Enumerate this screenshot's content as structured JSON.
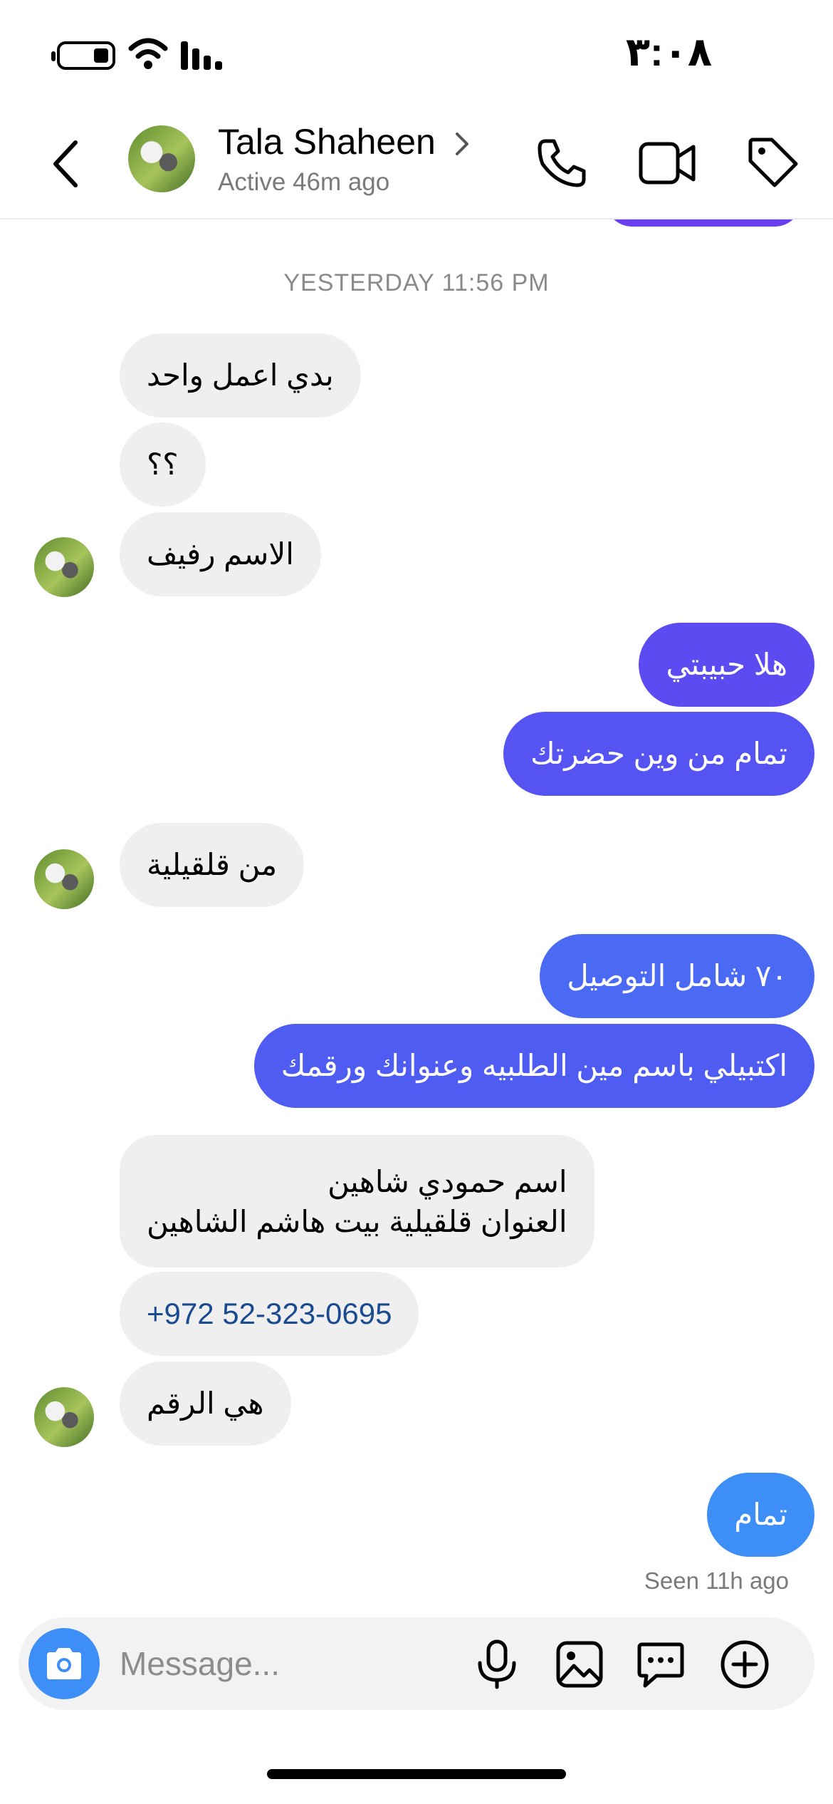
{
  "status_bar": {
    "time": "٣:٠٨"
  },
  "header": {
    "contact_name": "Tala Shaheen",
    "active_status": "Active 46m ago"
  },
  "chat": {
    "timestamp": "YESTERDAY 11:56 PM",
    "messages": [
      {
        "dir": "in",
        "text": "بدي اعمل واحد"
      },
      {
        "dir": "in",
        "text": "؟؟"
      },
      {
        "dir": "in",
        "text": "الاسم  رفيف"
      },
      {
        "dir": "out",
        "text": "هلا حبيبتي"
      },
      {
        "dir": "out",
        "text": "تمام من وين حضرتك"
      },
      {
        "dir": "in",
        "text": "من  قلقيلية"
      },
      {
        "dir": "out",
        "text": "٧٠ شامل التوصيل"
      },
      {
        "dir": "out",
        "text": "اكتبيلي باسم مين الطلبيه وعنوانك ورقمك"
      },
      {
        "dir": "in",
        "line1": "اسم حمودي شاهين",
        "line2": "العنوان قلقيلية بيت هاشم الشاهين"
      },
      {
        "dir": "in",
        "text": "+972 52-323-0695"
      },
      {
        "dir": "in",
        "text": "هي الرقم"
      },
      {
        "dir": "out",
        "text": "تمام"
      }
    ],
    "seen": "Seen 11h ago"
  },
  "composer": {
    "placeholder": "Message..."
  },
  "colors": {
    "incoming_bubble": "#efefef",
    "outgoing_purple": "#5b4bf0",
    "outgoing_indigo": "#4f5cf2",
    "outgoing_blue": "#4a78f5",
    "outgoing_light_blue": "#3e8ef7",
    "camera_button": "#3e8ef7"
  },
  "icons": [
    "battery-icon",
    "wifi-icon",
    "signal-icon",
    "back-icon",
    "chevron-right-icon",
    "phone-icon",
    "video-icon",
    "tag-icon",
    "camera-icon",
    "mic-icon",
    "image-icon",
    "sticker-icon",
    "plus-icon"
  ]
}
